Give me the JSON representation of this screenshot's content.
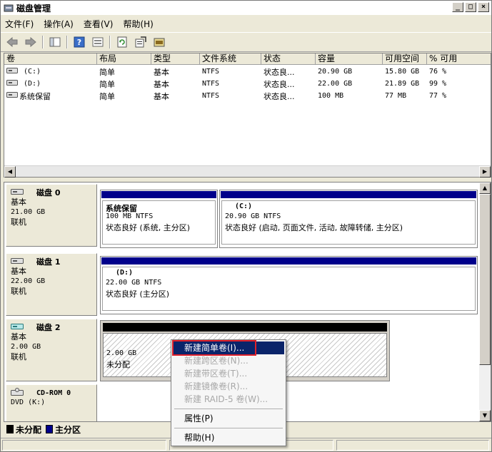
{
  "window": {
    "title": "磁盘管理",
    "minimize": "_",
    "maximize": "□",
    "close": "×"
  },
  "menubar": [
    "文件(F)",
    "操作(A)",
    "查看(V)",
    "帮助(H)"
  ],
  "toolbar": [
    "back-icon",
    "forward-icon",
    "panel-icon",
    "help-icon",
    "view-icon",
    "refresh-icon",
    "properties-icon",
    "wizard-icon"
  ],
  "volume_table": {
    "columns": [
      "卷",
      "布局",
      "类型",
      "文件系统",
      "状态",
      "容量",
      "可用空间",
      "% 可用"
    ],
    "rows": [
      {
        "volume": "(C:)",
        "layout": "简单",
        "type": "基本",
        "fs": "NTFS",
        "status": "状态良...",
        "capacity": "20.90 GB",
        "free": "15.80 GB",
        "pct": "76 %"
      },
      {
        "volume": "(D:)",
        "layout": "简单",
        "type": "基本",
        "fs": "NTFS",
        "status": "状态良...",
        "capacity": "22.00 GB",
        "free": "21.89 GB",
        "pct": "99 %"
      },
      {
        "volume": "系统保留",
        "layout": "简单",
        "type": "基本",
        "fs": "NTFS",
        "status": "状态良...",
        "capacity": "100 MB",
        "free": "77 MB",
        "pct": "77 %"
      }
    ]
  },
  "disks": [
    {
      "name": "磁盘 0",
      "type": "基本",
      "size": "21.00 GB",
      "state": "联机",
      "partitions": [
        {
          "name": "系统保留",
          "size": "100 MB NTFS",
          "status": "状态良好 (系统, 主分区)"
        },
        {
          "name": "(C:)",
          "size": "20.90 GB NTFS",
          "status": "状态良好 (启动, 页面文件, 活动, 故障转储, 主分区)"
        }
      ]
    },
    {
      "name": "磁盘 1",
      "type": "基本",
      "size": "22.00 GB",
      "state": "联机",
      "partitions": [
        {
          "name": "(D:)",
          "size": "22.00 GB NTFS",
          "status": "状态良好 (主分区)"
        }
      ]
    },
    {
      "name": "磁盘 2",
      "type": "基本",
      "size": "2.00 GB",
      "state": "联机",
      "partitions": [
        {
          "name": "",
          "size": "2.00 GB",
          "status": "未分配"
        }
      ]
    },
    {
      "name": "CD-ROM 0",
      "type": "DVD (K:)",
      "size": "",
      "state": ""
    }
  ],
  "legend": [
    {
      "label": "未分配",
      "color": "#000000"
    },
    {
      "label": "主分区",
      "color": "#00008b"
    }
  ],
  "context_menu": {
    "items": [
      {
        "label": "新建简单卷(I)...",
        "enabled": true,
        "highlight": true
      },
      {
        "label": "新建跨区卷(N)...",
        "enabled": false
      },
      {
        "label": "新建带区卷(T)...",
        "enabled": false
      },
      {
        "label": "新建镜像卷(R)...",
        "enabled": false
      },
      {
        "label": "新建 RAID-5 卷(W)...",
        "enabled": false
      }
    ],
    "properties": "属性(P)",
    "help": "帮助(H)"
  }
}
